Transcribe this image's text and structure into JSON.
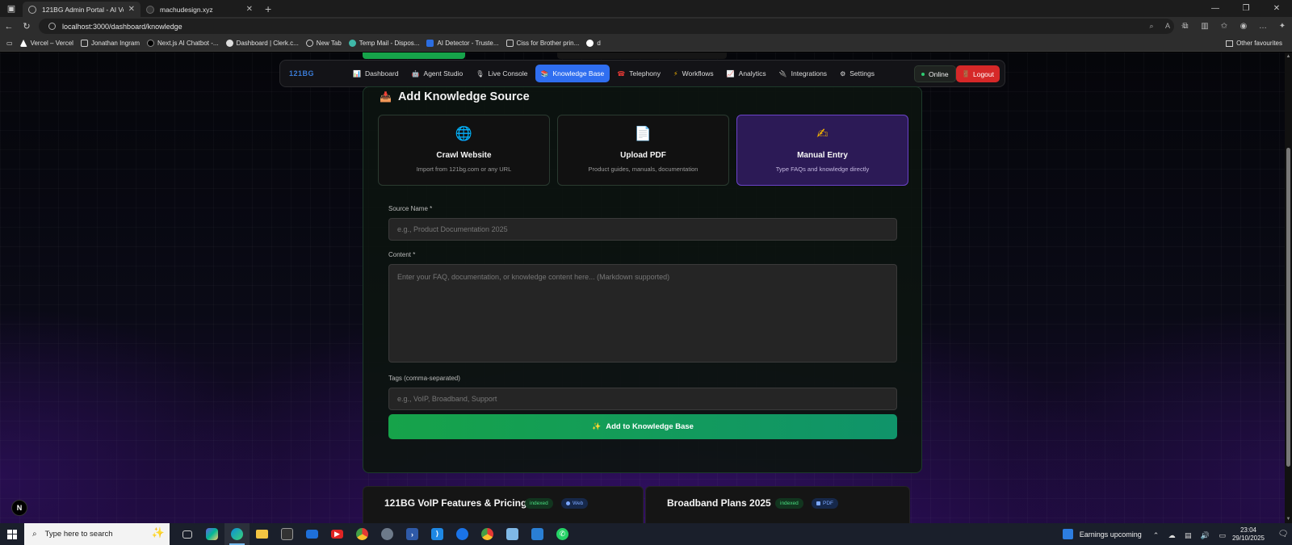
{
  "browser": {
    "tabs": [
      {
        "title": "121BG Admin Portal - AI Voice Ag",
        "active": true
      },
      {
        "title": "machudesign.xyz",
        "active": false
      }
    ],
    "url": "localhost:3000/dashboard/knowledge",
    "bookmarks": [
      {
        "label": "Vercel – Vercel",
        "icon": "vercel-icon"
      },
      {
        "label": "Jonathan Ingram",
        "icon": "folder-icon"
      },
      {
        "label": "Next.js AI Chatbot -...",
        "icon": "nextjs-icon"
      },
      {
        "label": "Dashboard | Clerk.c...",
        "icon": "clerk-icon"
      },
      {
        "label": "New Tab",
        "icon": "globe-icon"
      },
      {
        "label": "Temp Mail - Dispos...",
        "icon": "tempmail-icon"
      },
      {
        "label": "AI Detector - Truste...",
        "icon": "ai-detector-icon"
      },
      {
        "label": "Ciss for Brother prin...",
        "icon": "image-icon"
      },
      {
        "label": "d",
        "icon": "google-icon"
      }
    ],
    "other_favourites": "Other favourites"
  },
  "nav": {
    "logo": "121BG",
    "items": [
      {
        "label": "Dashboard",
        "icon": "📊"
      },
      {
        "label": "Agent Studio",
        "icon": "🤖"
      },
      {
        "label": "Live Console",
        "icon": "🎙"
      },
      {
        "label": "Knowledge Base",
        "icon": "📚",
        "active": true
      },
      {
        "label": "Telephony",
        "icon": "☎"
      },
      {
        "label": "Workflows",
        "icon": "⚡"
      },
      {
        "label": "Analytics",
        "icon": "📈"
      },
      {
        "label": "Integrations",
        "icon": "🔌"
      },
      {
        "label": "Settings",
        "icon": "⚙"
      }
    ],
    "status": "Online",
    "logout": "Logout"
  },
  "knowledge": {
    "title": "Add Knowledge Source",
    "sources": [
      {
        "title": "Crawl Website",
        "desc": "Import from 121bg.com or any URL",
        "icon": "🌐",
        "selected": false
      },
      {
        "title": "Upload PDF",
        "desc": "Product guides, manuals, documentation",
        "icon": "📄",
        "selected": false
      },
      {
        "title": "Manual Entry",
        "desc": "Type FAQs and knowledge directly",
        "icon": "✍",
        "selected": true
      }
    ],
    "form": {
      "source_name_label": "Source Name *",
      "source_name_placeholder": "e.g., Product Documentation 2025",
      "content_label": "Content *",
      "content_placeholder": "Enter your FAQ, documentation, or knowledge content here... (Markdown supported)",
      "tags_label": "Tags (comma-separated)",
      "tags_placeholder": "e.g., VoIP, Broadband, Support",
      "submit": "Add to Knowledge Base",
      "submit_icon": "✨"
    },
    "cards": [
      {
        "title": "121BG VoIP Features & Pricing",
        "status": "indexed",
        "type": "Web"
      },
      {
        "title": "Broadband Plans 2025",
        "status": "indexed",
        "type": "PDF"
      }
    ]
  },
  "taskbar": {
    "search_placeholder": "Type here to search",
    "news": "Earnings upcoming",
    "time": "23:04",
    "date": "29/10/2025"
  },
  "colors": {
    "accent_blue": "#2f6ef0",
    "accent_green": "#16a34a",
    "logout_red": "#d62828",
    "selected_purple": "#2c1a56"
  }
}
